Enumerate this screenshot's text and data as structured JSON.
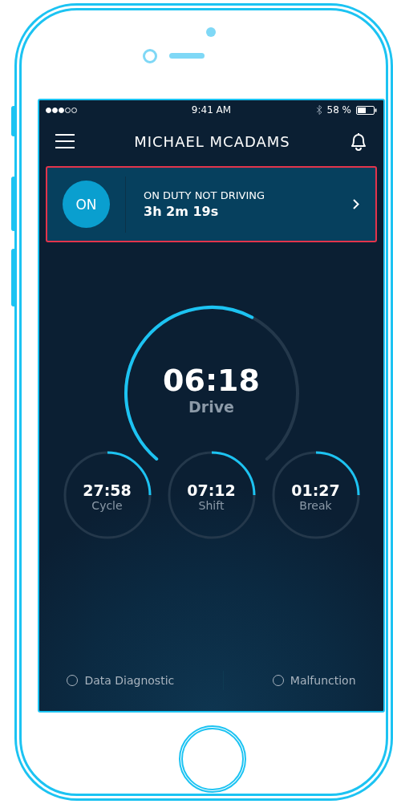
{
  "status_bar": {
    "time": "9:41 AM",
    "battery": "58 %"
  },
  "header": {
    "title": "MICHAEL MCADAMS"
  },
  "duty_card": {
    "badge": "ON",
    "status": "ON DUTY NOT DRIVING",
    "duration": "3h 2m 19s"
  },
  "main_gauge": {
    "value": "06:18",
    "label": "Drive",
    "level": 0.6
  },
  "gauges": [
    {
      "value": "27:58",
      "label": "Cycle",
      "level": 0.25
    },
    {
      "value": "07:12",
      "label": "Shift",
      "level": 0.25
    },
    {
      "value": "01:27",
      "label": "Break",
      "level": 0.25
    }
  ],
  "indicators": [
    {
      "label": "Data Diagnostic",
      "checked": false
    },
    {
      "label": "Malfunction",
      "checked": false
    }
  ]
}
